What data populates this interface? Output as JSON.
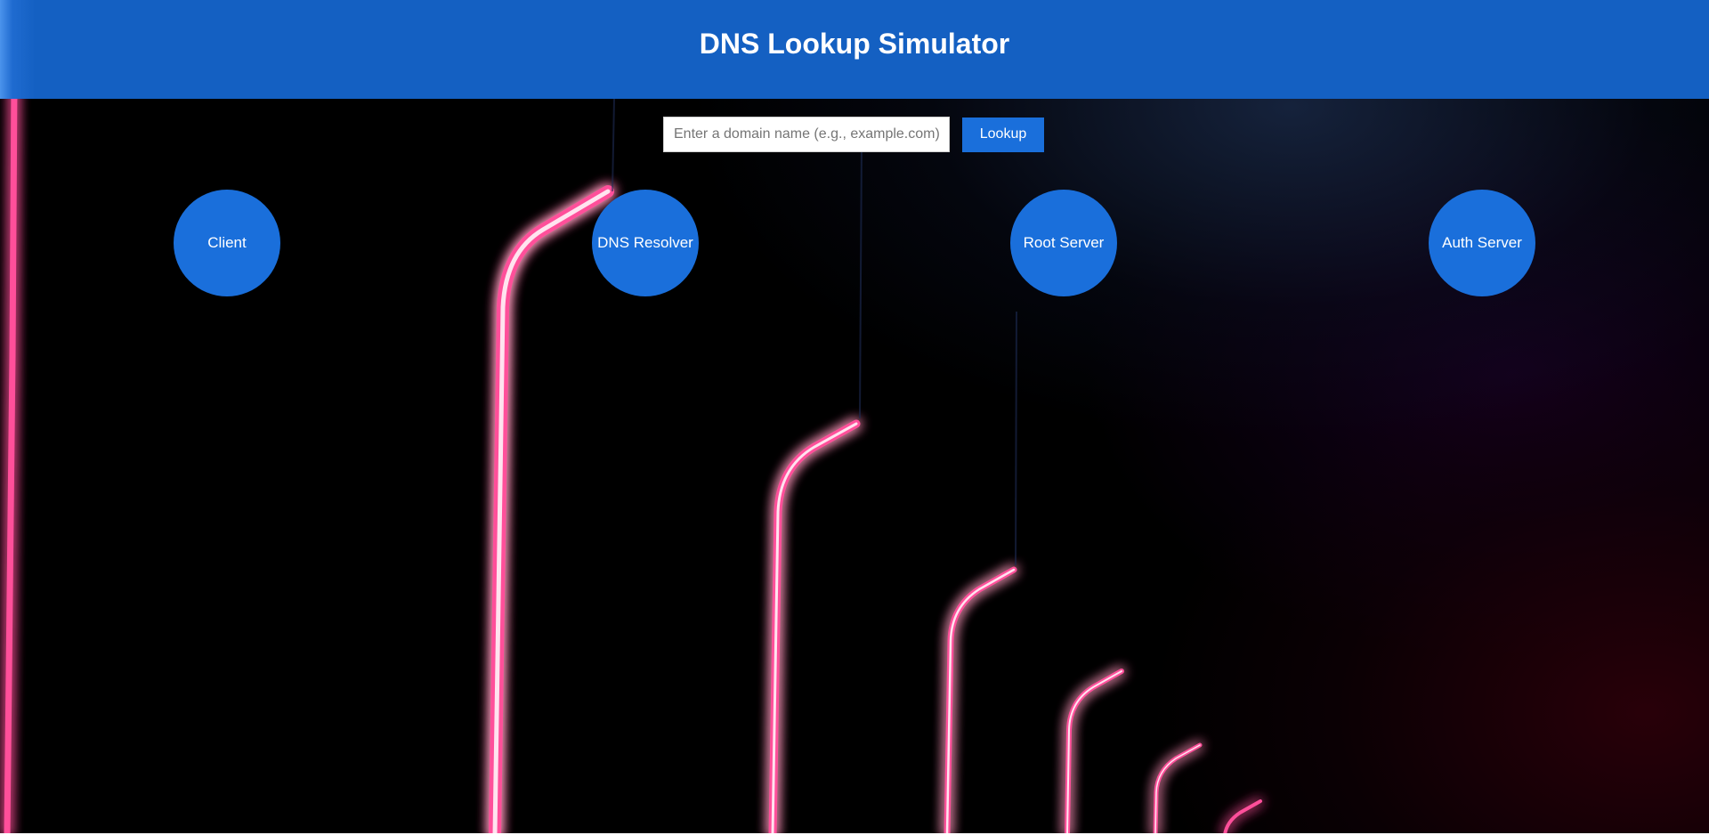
{
  "header": {
    "title": "DNS Lookup Simulator"
  },
  "search": {
    "placeholder": "Enter a domain name (e.g., example.com)",
    "value": "",
    "button_label": "Lookup"
  },
  "nodes": [
    {
      "label": "Client"
    },
    {
      "label": "DNS Resolver"
    },
    {
      "label": "Root Server"
    },
    {
      "label": "Auth Server"
    }
  ],
  "colors": {
    "header_bg": "#1460c2",
    "accent": "#1a6fdb",
    "background": "#000000",
    "neon_line": "#ff4f9a"
  }
}
